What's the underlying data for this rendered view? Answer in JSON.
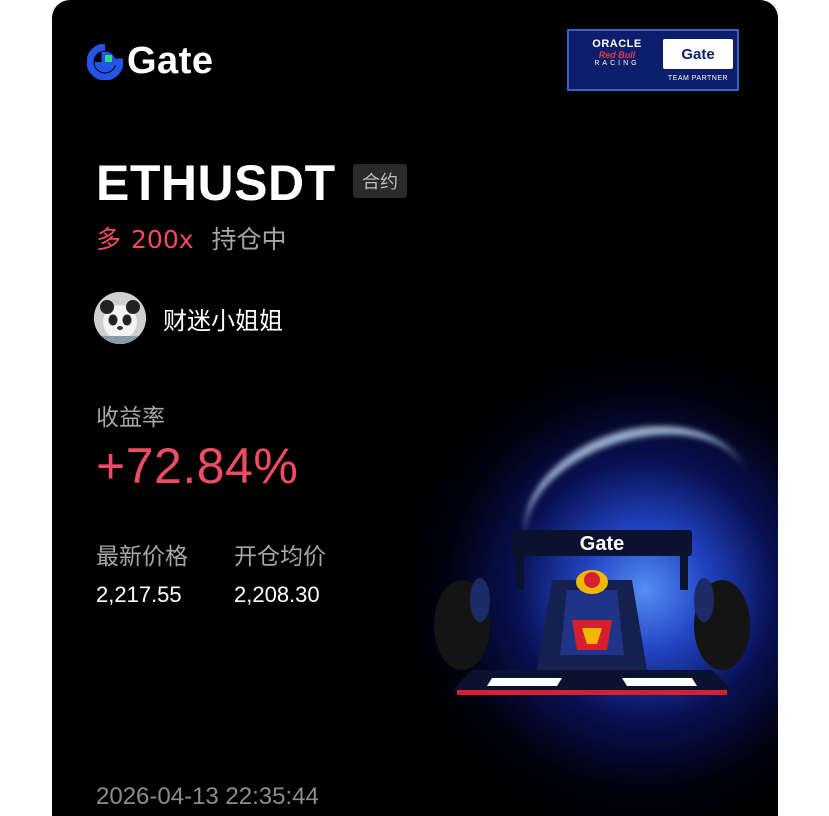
{
  "brand": {
    "name": "Gate",
    "icon": "gate-logo-icon"
  },
  "sponsor": {
    "oracle": "ORACLE",
    "redbull": "Red Bull",
    "racing": "RACING",
    "gate": "Gate",
    "partner": "TEAM PARTNER"
  },
  "position": {
    "symbol": "ETHUSDT",
    "type_tag": "合约",
    "side": "多",
    "leverage": "200x",
    "status": "持仓中"
  },
  "user": {
    "name": "财迷小姐姐",
    "avatar_icon": "panda-avatar-icon"
  },
  "stats": {
    "roi_label": "收益率",
    "roi_value": "+72.84%",
    "last_price_label": "最新价格",
    "last_price": "2,217.55",
    "entry_price_label": "开仓均价",
    "entry_price": "2,208.30"
  },
  "timestamp": "2026-04-13 22:35:44",
  "car_livery": "Gate",
  "colors": {
    "background": "#000000",
    "profit": "#ef4b63",
    "muted": "#a6a6a6",
    "brand_blue": "#2354e6"
  }
}
